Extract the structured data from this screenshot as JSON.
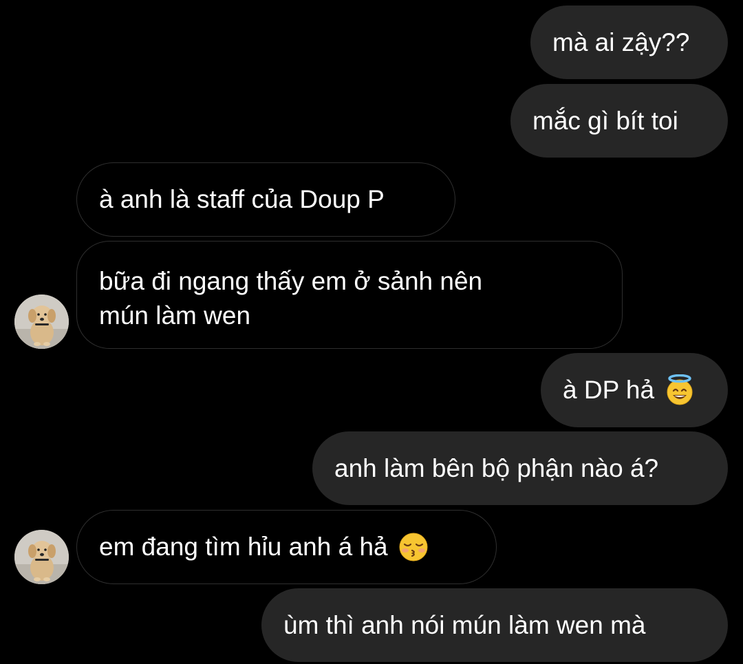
{
  "conversation": {
    "messages": [
      {
        "from": "me",
        "text": "mà ai zậy??"
      },
      {
        "from": "me",
        "text": "mắc gì bít toi"
      },
      {
        "from": "them",
        "text": "à anh là staff của Doup P"
      },
      {
        "from": "them",
        "line1": "bữa đi ngang thấy em ở sảnh nên",
        "line2": "mún làm wen"
      },
      {
        "from": "me",
        "text": "à DP hả",
        "emoji": "smiling-face-with-halo-emoji"
      },
      {
        "from": "me",
        "text": "anh làm bên bộ phận nào á?"
      },
      {
        "from": "them",
        "text": "em đang tìm hỉu anh á hả",
        "emoji": "kissing-face-with-closed-eyes-emoji"
      },
      {
        "from": "me",
        "text": "ùm thì anh nói mún làm wen mà"
      }
    ],
    "avatar_icon": "puppy-avatar"
  },
  "colors": {
    "background": "#000000",
    "outgoing_bubble": "#262626",
    "incoming_border": "#2f2f2f",
    "text": "#ffffff"
  }
}
